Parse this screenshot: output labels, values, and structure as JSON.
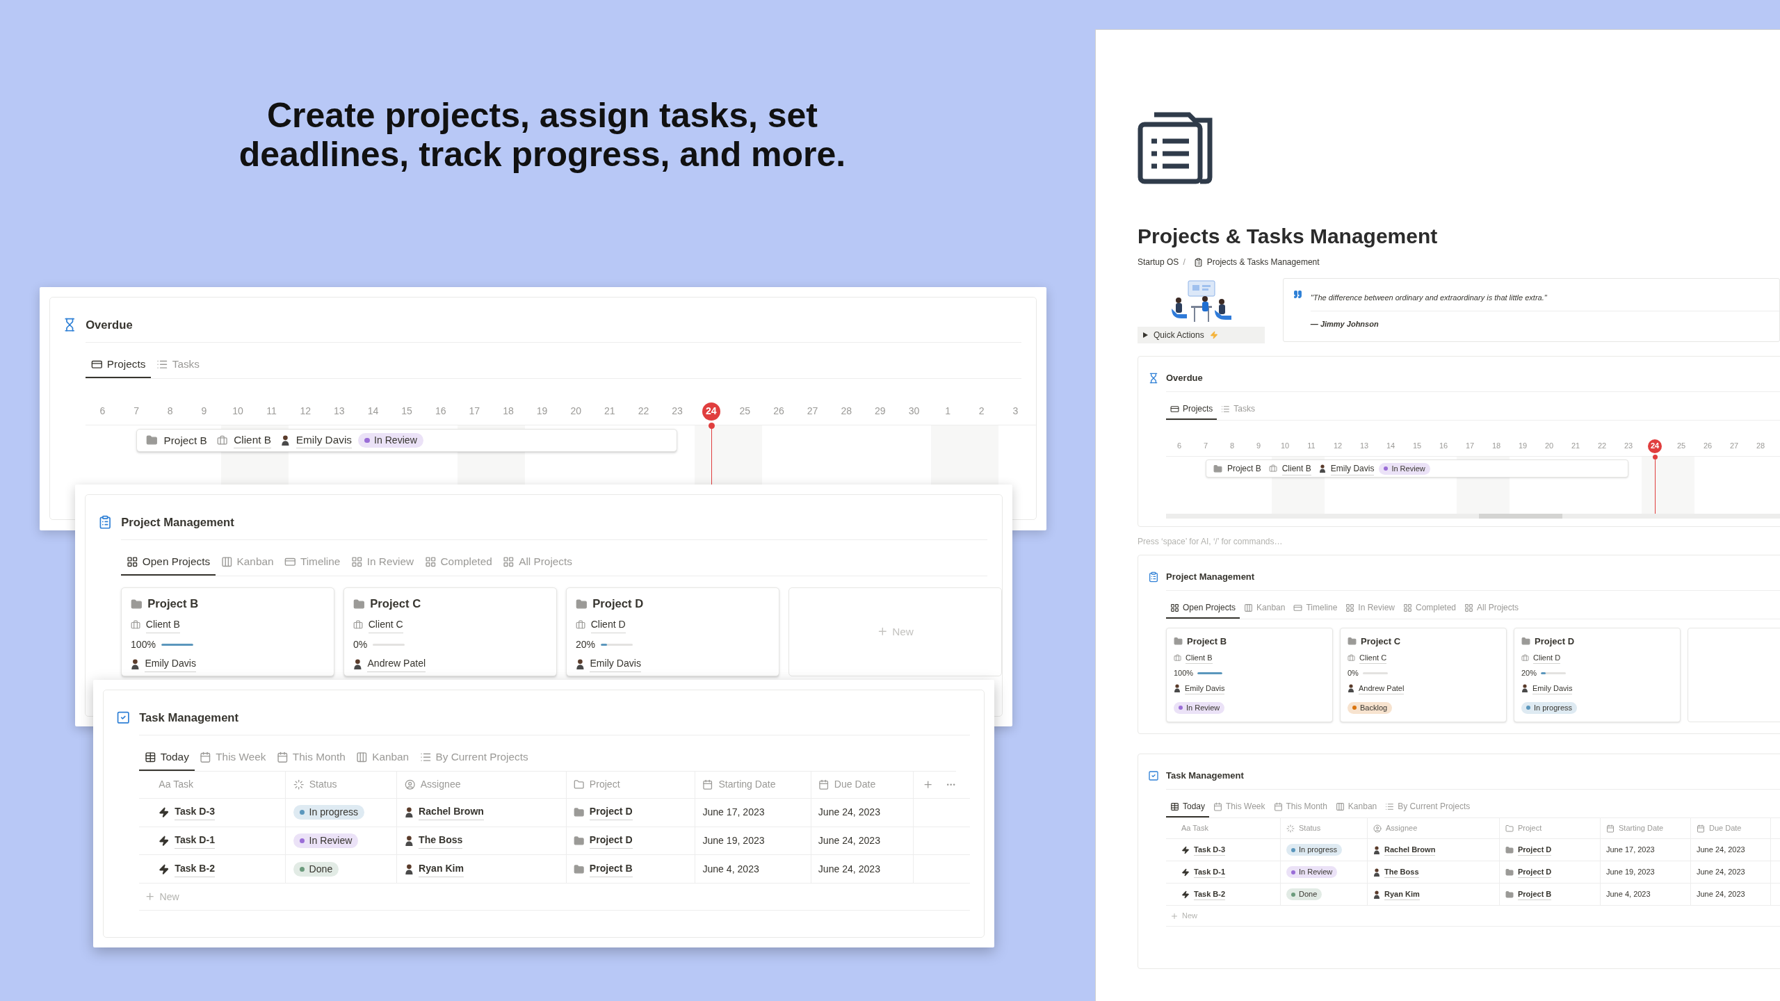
{
  "headline": "Create projects, assign tasks, set deadlines, track progress, and more.",
  "left_mockup": {
    "overdue": {
      "title": "Overdue",
      "tabs": [
        {
          "label": "Projects",
          "kind": "timeline",
          "selected": true
        },
        {
          "label": "Tasks",
          "kind": "list",
          "selected": false
        }
      ],
      "days": [
        {
          "label": "6",
          "today": false
        },
        {
          "label": "7",
          "today": false
        },
        {
          "label": "8",
          "today": false
        },
        {
          "label": "9",
          "today": false
        },
        {
          "label": "10",
          "today": false
        },
        {
          "label": "11",
          "today": false
        },
        {
          "label": "12",
          "today": false
        },
        {
          "label": "13",
          "today": false
        },
        {
          "label": "14",
          "today": false
        },
        {
          "label": "15",
          "today": false
        },
        {
          "label": "16",
          "today": false
        },
        {
          "label": "17",
          "today": false
        },
        {
          "label": "18",
          "today": false
        },
        {
          "label": "19",
          "today": false
        },
        {
          "label": "20",
          "today": false
        },
        {
          "label": "21",
          "today": false
        },
        {
          "label": "22",
          "today": false
        },
        {
          "label": "23",
          "today": false
        },
        {
          "label": "24",
          "today": true
        },
        {
          "label": "25",
          "today": false
        },
        {
          "label": "26",
          "today": false
        },
        {
          "label": "27",
          "today": false
        },
        {
          "label": "28",
          "today": false
        },
        {
          "label": "29",
          "today": false
        },
        {
          "label": "30",
          "today": false
        },
        {
          "label": "1",
          "today": false
        },
        {
          "label": "2",
          "today": false
        },
        {
          "label": "3",
          "today": false
        }
      ],
      "bar": {
        "project": "Project B",
        "client": "Client B",
        "assignee": "Emily Davis",
        "status": {
          "label": "In Review",
          "color": "#9a6dd7"
        }
      }
    },
    "project_management": {
      "title": "Project Management",
      "tabs": [
        {
          "label": "Open Projects",
          "kind": "gallery",
          "selected": true
        },
        {
          "label": "Kanban",
          "kind": "board",
          "selected": false
        },
        {
          "label": "Timeline",
          "kind": "timeline",
          "selected": false
        },
        {
          "label": "In Review",
          "kind": "gallery",
          "selected": false
        },
        {
          "label": "Completed",
          "kind": "gallery",
          "selected": false
        },
        {
          "label": "All Projects",
          "kind": "gallery",
          "selected": false
        }
      ],
      "projects": [
        {
          "name": "Project B",
          "client": "Client B",
          "progress": "100%",
          "level": 1,
          "assignee": "Emily Davis"
        },
        {
          "name": "Project C",
          "client": "Client C",
          "progress": "0%",
          "level": 0,
          "assignee": "Andrew Patel"
        },
        {
          "name": "Project D",
          "client": "Client D",
          "progress": "20%",
          "level": 0.2,
          "assignee": "Emily Davis"
        }
      ],
      "new_card": "New"
    },
    "task_management": {
      "title": "Task Management",
      "tabs": [
        {
          "label": "Today",
          "kind": "table",
          "selected": true
        },
        {
          "label": "This Week",
          "kind": "calendar",
          "selected": false
        },
        {
          "label": "This Month",
          "kind": "calendar",
          "selected": false
        },
        {
          "label": "Kanban",
          "kind": "board",
          "selected": false
        },
        {
          "label": "By Current Projects",
          "kind": "list",
          "selected": false
        }
      ],
      "columns": [
        "Aa Task",
        "Status",
        "Assignee",
        "Project",
        "Starting Date",
        "Due Date"
      ],
      "rows": [
        {
          "task": "Task D-3",
          "status": {
            "label": "In progress",
            "color": "#5b97bd"
          },
          "assignee": "Rachel Brown",
          "project": "Project D",
          "start": "June 17, 2023",
          "due": "June 24, 2023"
        },
        {
          "task": "Task D-1",
          "status": {
            "label": "In Review",
            "color": "#9a6dd7"
          },
          "assignee": "The Boss",
          "project": "Project D",
          "start": "June 19, 2023",
          "due": "June 24, 2023"
        },
        {
          "task": "Task B-2",
          "status": {
            "label": "Done",
            "color": "#6c9b7d"
          },
          "assignee": "Ryan Kim",
          "project": "Project B",
          "start": "June 4, 2023",
          "due": "June 24, 2023"
        }
      ],
      "new_row": "New"
    }
  },
  "page": {
    "title": "Projects & Tasks Management",
    "breadcrumb": [
      "Startup OS",
      "Projects & Tasks Management"
    ],
    "separator": "/",
    "quick_actions": "Quick Actions",
    "quote": {
      "text": "\"The difference between ordinary and extraordinary is that little extra.\"",
      "author": "— Jimmy Johnson"
    },
    "overdue": {
      "title": "Overdue",
      "tabs": [
        {
          "label": "Projects",
          "kind": "timeline",
          "selected": true
        },
        {
          "label": "Tasks",
          "kind": "list",
          "selected": false
        }
      ],
      "days": [
        {
          "label": "6",
          "today": false
        },
        {
          "label": "7",
          "today": false
        },
        {
          "label": "8",
          "today": false
        },
        {
          "label": "9",
          "today": false
        },
        {
          "label": "10",
          "today": false
        },
        {
          "label": "11",
          "today": false
        },
        {
          "label": "12",
          "today": false
        },
        {
          "label": "13",
          "today": false
        },
        {
          "label": "14",
          "today": false
        },
        {
          "label": "15",
          "today": false
        },
        {
          "label": "16",
          "today": false
        },
        {
          "label": "17",
          "today": false
        },
        {
          "label": "18",
          "today": false
        },
        {
          "label": "19",
          "today": false
        },
        {
          "label": "20",
          "today": false
        },
        {
          "label": "21",
          "today": false
        },
        {
          "label": "22",
          "today": false
        },
        {
          "label": "23",
          "today": false
        },
        {
          "label": "24",
          "today": true
        },
        {
          "label": "25",
          "today": false
        },
        {
          "label": "26",
          "today": false
        },
        {
          "label": "27",
          "today": false
        },
        {
          "label": "28",
          "today": false
        }
      ],
      "bar": {
        "project": "Project B",
        "client": "Client B",
        "assignee": "Emily Davis",
        "status": {
          "label": "In Review",
          "color": "#9a6dd7"
        }
      }
    },
    "hint": "Press ‘space’ for AI, ‘/’ for commands…",
    "project_management": {
      "title": "Project Management",
      "tabs": [
        {
          "label": "Open Projects",
          "kind": "gallery",
          "selected": true
        },
        {
          "label": "Kanban",
          "kind": "board",
          "selected": false
        },
        {
          "label": "Timeline",
          "kind": "timeline",
          "selected": false
        },
        {
          "label": "In Review",
          "kind": "gallery",
          "selected": false
        },
        {
          "label": "Completed",
          "kind": "gallery",
          "selected": false
        },
        {
          "label": "All Projects",
          "kind": "gallery",
          "selected": false
        }
      ],
      "projects": [
        {
          "name": "Project B",
          "client": "Client B",
          "progress": "100%",
          "level": 1,
          "assignee": "Emily Davis",
          "status": {
            "label": "In Review",
            "color": "#9a6dd7"
          }
        },
        {
          "name": "Project C",
          "client": "Client C",
          "progress": "0%",
          "level": 0,
          "assignee": "Andrew Patel",
          "status": {
            "label": "Backlog",
            "color": "#d9730d"
          }
        },
        {
          "name": "Project D",
          "client": "Client D",
          "progress": "20%",
          "level": 0.2,
          "assignee": "Emily Davis",
          "status": {
            "label": "In progress",
            "color": "#5b97bd"
          }
        }
      ]
    },
    "task_management": {
      "title": "Task Management",
      "tabs": [
        {
          "label": "Today",
          "kind": "table",
          "selected": true
        },
        {
          "label": "This Week",
          "kind": "calendar",
          "selected": false
        },
        {
          "label": "This Month",
          "kind": "calendar",
          "selected": false
        },
        {
          "label": "Kanban",
          "kind": "board",
          "selected": false
        },
        {
          "label": "By Current Projects",
          "kind": "list",
          "selected": false
        }
      ],
      "columns": [
        "Aa Task",
        "Status",
        "Assignee",
        "Project",
        "Starting Date",
        "Due Date"
      ],
      "rows": [
        {
          "task": "Task D-3",
          "status": {
            "label": "In progress",
            "color": "#5b97bd"
          },
          "assignee": "Rachel Brown",
          "project": "Project D",
          "start": "June 17, 2023",
          "due": "June 24, 2023"
        },
        {
          "task": "Task D-1",
          "status": {
            "label": "In Review",
            "color": "#9a6dd7"
          },
          "assignee": "The Boss",
          "project": "Project D",
          "start": "June 19, 2023",
          "due": "June 24, 2023"
        },
        {
          "task": "Task B-2",
          "status": {
            "label": "Done",
            "color": "#6c9b7d"
          },
          "assignee": "Ryan Kim",
          "project": "Project B",
          "start": "June 4, 2023",
          "due": "June 24, 2023"
        }
      ],
      "new_row": "New"
    }
  }
}
